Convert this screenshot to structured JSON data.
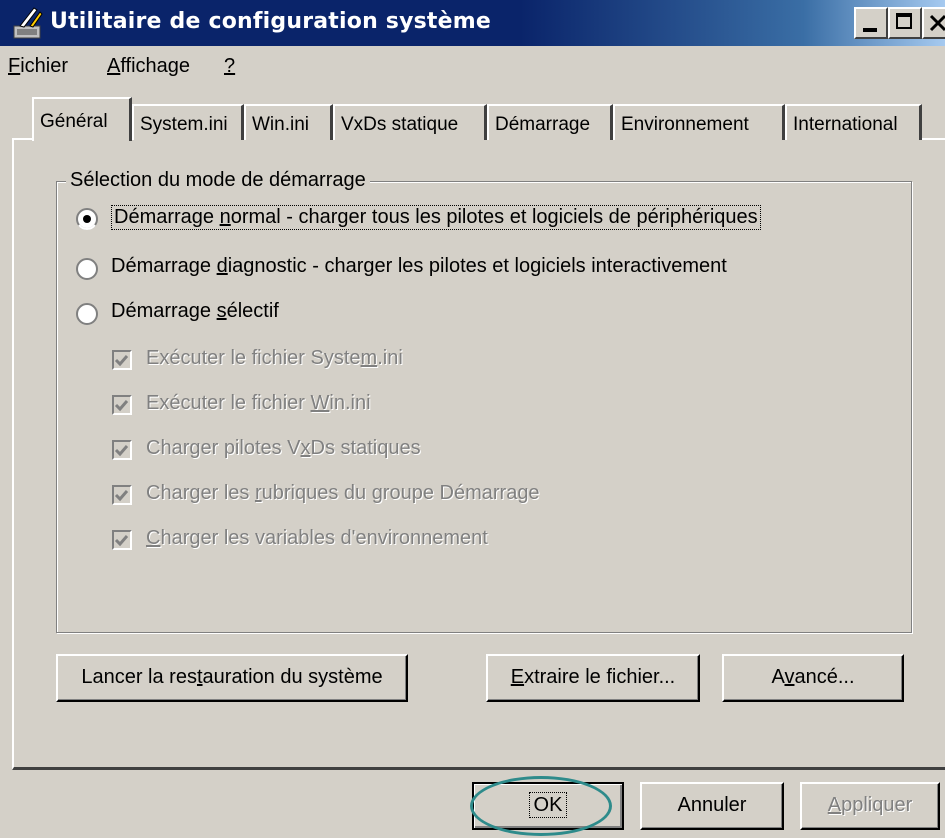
{
  "window": {
    "title": "Utilitaire de configuration système",
    "icon": "msconfig-icon"
  },
  "menu": {
    "file_pre": "",
    "file_key": "F",
    "file_rest": "ichier",
    "view_pre": "",
    "view_key": "A",
    "view_rest": "ffichage",
    "help_key": "?"
  },
  "tabs": [
    {
      "label": "Général",
      "active": true
    },
    {
      "label": "System.ini"
    },
    {
      "label": "Win.ini"
    },
    {
      "label": "VxDs statique"
    },
    {
      "label": "Démarrage"
    },
    {
      "label": "Environnement"
    },
    {
      "label": "International"
    }
  ],
  "group": {
    "legend": "Sélection du mode de démarrage"
  },
  "radios": [
    {
      "pre": "Démarrage ",
      "key": "n",
      "rest": "ormal - charger tous les pilotes et logiciels de périphériques",
      "checked": true
    },
    {
      "pre": "Démarrage ",
      "key": "d",
      "rest": "iagnostic - charger les pilotes et logiciels interactivement",
      "checked": false
    },
    {
      "pre": "Démarrage ",
      "key": "s",
      "rest": "électif",
      "checked": false
    }
  ],
  "checkboxes": [
    {
      "pre": "Exécuter le fichier Syste",
      "key": "m",
      "rest": ".ini",
      "checked": true
    },
    {
      "pre": "Exécuter le fichier ",
      "key": "W",
      "rest": "in.ini",
      "checked": true
    },
    {
      "pre": "Charger pilotes V",
      "key": "x",
      "rest": "Ds statiques",
      "checked": true
    },
    {
      "pre": "Charger les ",
      "key": "r",
      "rest": "ubriques du groupe Démarrage",
      "checked": true
    },
    {
      "pre": "",
      "key": "C",
      "rest": "harger les variables d'environnement",
      "checked": true
    }
  ],
  "buttons": {
    "restore_pre": "Lancer la res",
    "restore_key": "t",
    "restore_rest": "auration du système",
    "extract_pre": "",
    "extract_key": "E",
    "extract_rest": "xtraire le fichier...",
    "advanced_pre": "A",
    "advanced_key": "v",
    "advanced_rest": "ancé...",
    "ok": "OK",
    "cancel": "Annuler",
    "apply_pre": "",
    "apply_key": "A",
    "apply_rest": "ppliquer"
  },
  "colors": {
    "titlebar": "#0a246a",
    "face": "#d4d0c8",
    "highlight_ring": "#2e8b8b"
  }
}
